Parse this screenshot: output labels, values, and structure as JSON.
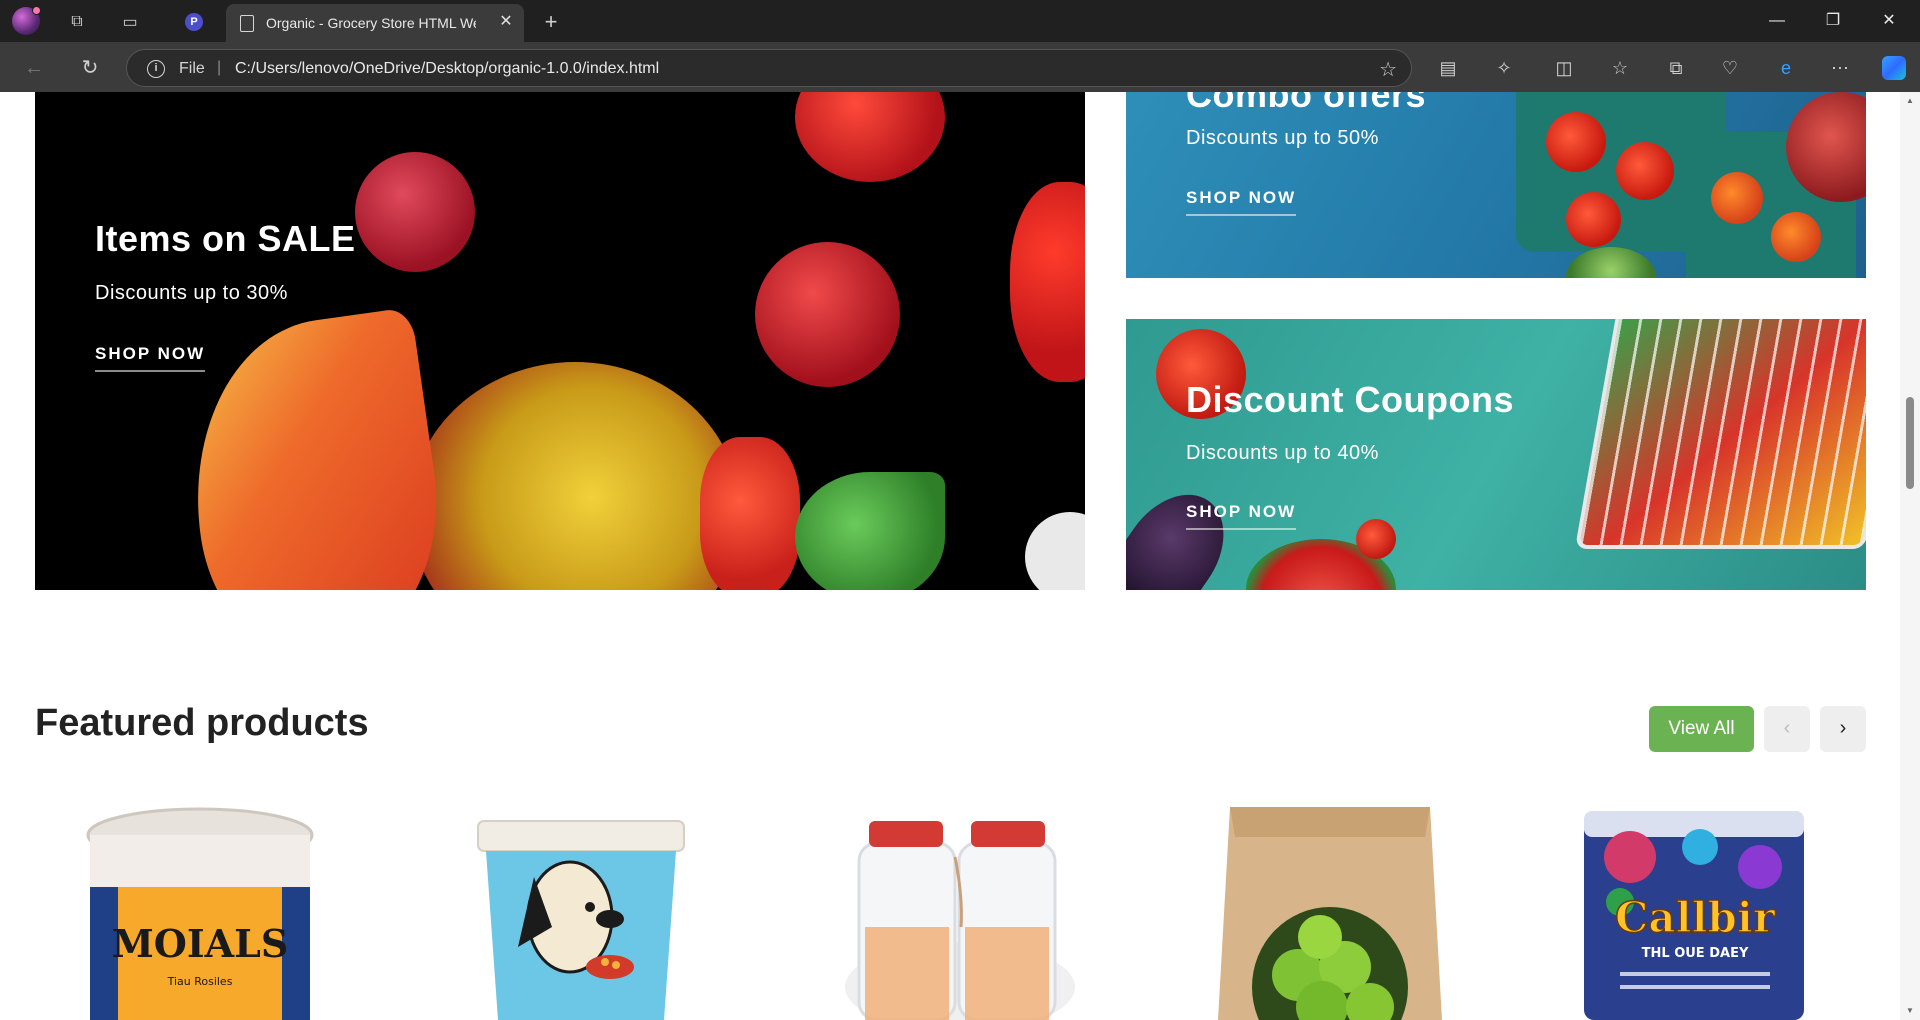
{
  "browser": {
    "tab_title": "Organic - Grocery Store HTML We",
    "file_label": "File",
    "url": "C:/Users/lenovo/OneDrive/Desktop/organic-1.0.0/index.html"
  },
  "banners": {
    "sale": {
      "title": "Items on SALE",
      "subtitle": "Discounts up to 30%",
      "button": "SHOP NOW"
    },
    "combo": {
      "title": "Combo offers",
      "subtitle": "Discounts up to 50%",
      "button": "SHOP NOW"
    },
    "coupons": {
      "title": "Discount Coupons",
      "subtitle": "Discounts up to 40%",
      "button": "SHOP NOW"
    }
  },
  "featured": {
    "title": "Featured products",
    "view_all": "View All",
    "prev": "‹",
    "next": "›"
  },
  "products": [
    {
      "label": "MOIALS",
      "sub": "Tiau Rosiles",
      "icon": "can-product"
    },
    {
      "label": "",
      "sub": "",
      "icon": "dog-food-product"
    },
    {
      "label": "",
      "sub": "",
      "icon": "jars-product"
    },
    {
      "label": "",
      "sub": "",
      "icon": "limes-bag-product"
    },
    {
      "label": "Callbir",
      "sub": "THL OUE DAEY",
      "icon": "snack-bag-product"
    }
  ],
  "colors": {
    "accent": "#6bb252",
    "chrome_dark": "#202020",
    "chrome_bar": "#3b3b3b"
  }
}
